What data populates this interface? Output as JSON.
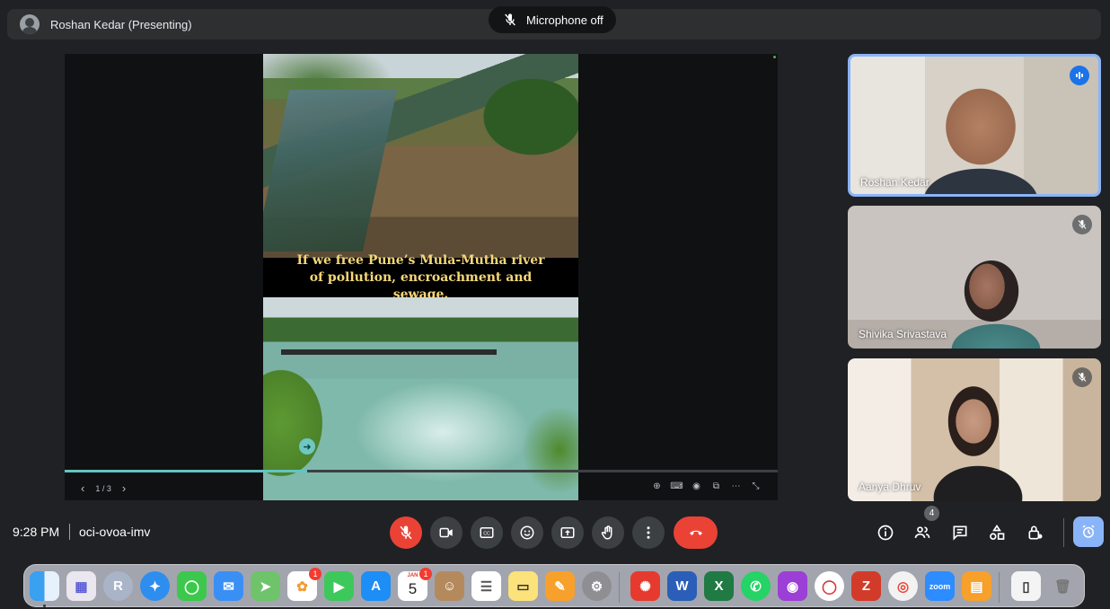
{
  "topbar": {
    "presenter_title": "Roshan Kedar (Presenting)",
    "mic_toast": "Microphone off"
  },
  "slide": {
    "caption": "If we free Pune’s Mula-Mutha river of pollution, encroachment and sewage.",
    "page_indicator": "1 / 3",
    "progress_fraction": 0.34
  },
  "participants": [
    {
      "name": "Roshan Kedar",
      "state": "speaking"
    },
    {
      "name": "Shivika Srivastava",
      "state": "muted"
    },
    {
      "name": "Aanya Dhruv",
      "state": "muted"
    }
  ],
  "bottombar": {
    "time": "9:28 PM",
    "meeting_code": "oci-ovoa-imv",
    "people_count": "4"
  },
  "dock": {
    "photos_badge": "1",
    "calendar_month": "JAN",
    "calendar_day": "5",
    "calendar_badge": "1",
    "zoom_label": "zoom"
  },
  "colors": {
    "background": "#202124",
    "accent_blue": "#8ab4f8",
    "danger_red": "#ea4335",
    "caption_yellow": "#f6d878",
    "progress_teal": "#64c4c2"
  }
}
